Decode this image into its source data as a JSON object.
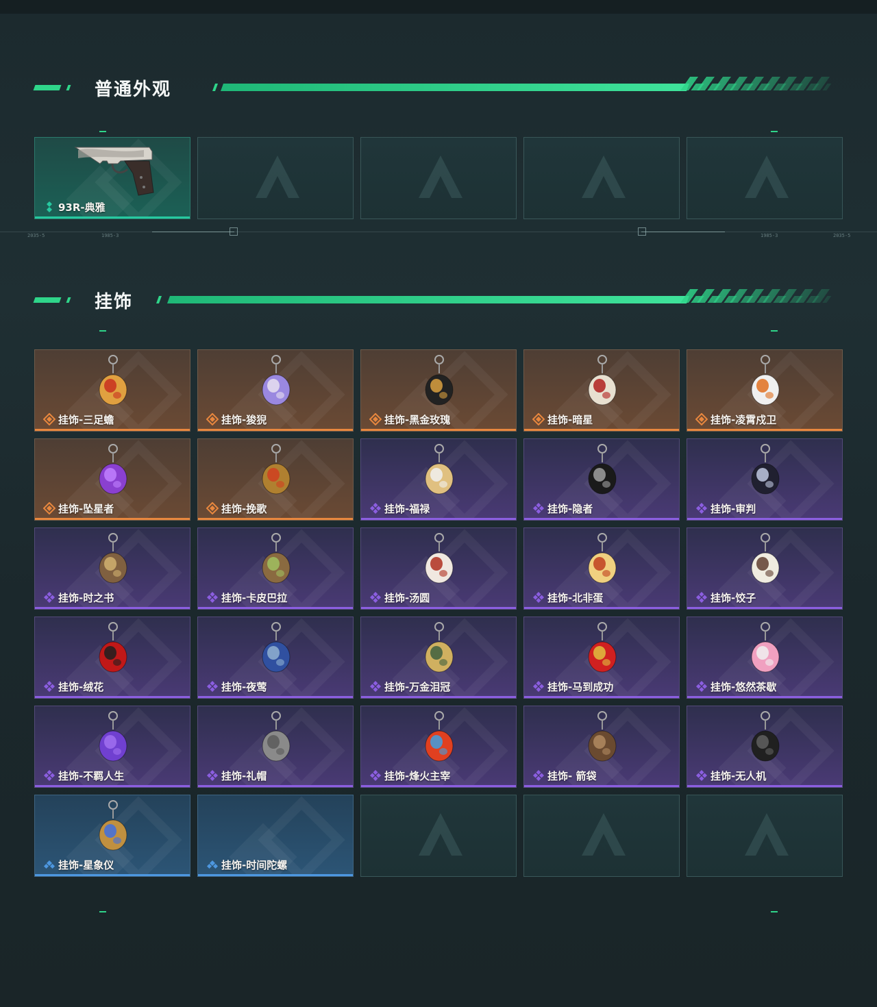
{
  "sections": [
    {
      "title": "普通外观"
    },
    {
      "title": "挂饰"
    }
  ],
  "ruler_labels": [
    "2035-5",
    "1985-3",
    "1985-3",
    "2035-5"
  ],
  "colors": {
    "accent": "#2fd58a",
    "rarity_green": "#27c9a0",
    "rarity_orange": "#e8873e",
    "rarity_purple": "#8b5ee0",
    "rarity_blue": "#4d97e0"
  },
  "skins": [
    {
      "label": "93R-典雅",
      "rarity": "green",
      "icon": "pistol-icon"
    },
    {
      "label": "",
      "rarity": "empty"
    },
    {
      "label": "",
      "rarity": "empty"
    },
    {
      "label": "",
      "rarity": "empty"
    },
    {
      "label": "",
      "rarity": "empty"
    }
  ],
  "charms": [
    {
      "label": "挂饰-三足蟾",
      "rarity": "orange",
      "icon": "toad-charm-icon",
      "c1": "#e0a040",
      "c2": "#c83020"
    },
    {
      "label": "挂饰-狻猊",
      "rarity": "orange",
      "icon": "lion-charm-icon",
      "c1": "#9a88e0",
      "c2": "#e8e0f0"
    },
    {
      "label": "挂饰-黑金玫瑰",
      "rarity": "orange",
      "icon": "black-gold-rose-icon",
      "c1": "#222",
      "c2": "#d9a040"
    },
    {
      "label": "挂饰-暗星",
      "rarity": "orange",
      "icon": "dark-star-icon",
      "c1": "#e8e0d0",
      "c2": "#b02020"
    },
    {
      "label": "挂饰-凌霄戍卫",
      "rarity": "orange",
      "icon": "guardian-charm-icon",
      "c1": "#f0f0f0",
      "c2": "#e07020"
    },
    {
      "label": "挂饰-坠星者",
      "rarity": "orange",
      "icon": "crystal-charm-icon",
      "c1": "#8a40d0",
      "c2": "#c080ff"
    },
    {
      "label": "挂饰-挽歌",
      "rarity": "orange",
      "icon": "elegy-charm-icon",
      "c1": "#b08030",
      "c2": "#d04020"
    },
    {
      "label": "挂饰-福禄",
      "rarity": "purple",
      "icon": "gourd-charm-icon",
      "c1": "#e0c080",
      "c2": "#f0f0f0"
    },
    {
      "label": "挂饰-隐者",
      "rarity": "purple",
      "icon": "hermit-card-icon",
      "c1": "#1a1a1a",
      "c2": "#a0a0a0"
    },
    {
      "label": "挂饰-审判",
      "rarity": "purple",
      "icon": "judgement-card-icon",
      "c1": "#202030",
      "c2": "#c0c8e0"
    },
    {
      "label": "挂饰-时之书",
      "rarity": "purple",
      "icon": "book-charm-icon",
      "c1": "#806040",
      "c2": "#d0b070"
    },
    {
      "label": "挂饰-卡皮巴拉",
      "rarity": "purple",
      "icon": "capybara-charm-icon",
      "c1": "#8a6a40",
      "c2": "#a0c060"
    },
    {
      "label": "挂饰-汤圆",
      "rarity": "purple",
      "icon": "tangyuan-charm-icon",
      "c1": "#f0e8e0",
      "c2": "#b03020"
    },
    {
      "label": "挂饰-北非蛋",
      "rarity": "purple",
      "icon": "shakshuka-charm-icon",
      "c1": "#f0d080",
      "c2": "#c04020"
    },
    {
      "label": "挂饰-饺子",
      "rarity": "purple",
      "icon": "dumpling-charm-icon",
      "c1": "#f0ece0",
      "c2": "#604030"
    },
    {
      "label": "挂饰-绒花",
      "rarity": "purple",
      "icon": "velvet-flower-icon",
      "c1": "#c01818",
      "c2": "#202020"
    },
    {
      "label": "挂饰-夜莺",
      "rarity": "purple",
      "icon": "feather-charm-icon",
      "c1": "#3050a0",
      "c2": "#90b0d0"
    },
    {
      "label": "挂饰-万金泪冠",
      "rarity": "purple",
      "icon": "crown-charm-icon",
      "c1": "#d0b060",
      "c2": "#406040"
    },
    {
      "label": "挂饰-马到成功",
      "rarity": "purple",
      "icon": "horse-charm-icon",
      "c1": "#d02020",
      "c2": "#e0c040"
    },
    {
      "label": "挂饰-悠然茶歇",
      "rarity": "purple",
      "icon": "cupcake-charm-icon",
      "c1": "#f0a0c0",
      "c2": "#f0f0f0"
    },
    {
      "label": "挂饰-不羁人生",
      "rarity": "purple",
      "icon": "sneaker-charm-icon",
      "c1": "#7040d0",
      "c2": "#a070f0"
    },
    {
      "label": "挂饰-礼帽",
      "rarity": "purple",
      "icon": "hat-charm-icon",
      "c1": "#8a8a8a",
      "c2": "#5a5a5a"
    },
    {
      "label": "挂饰-烽火主宰",
      "rarity": "purple",
      "icon": "banner-charm-icon",
      "c1": "#e04020",
      "c2": "#40a0e0"
    },
    {
      "label": "挂饰- 箭袋",
      "rarity": "purple",
      "icon": "quiver-charm-icon",
      "c1": "#6a4a30",
      "c2": "#b08a60"
    },
    {
      "label": "挂饰-无人机",
      "rarity": "purple",
      "icon": "drone-charm-icon",
      "c1": "#202020",
      "c2": "#606060"
    },
    {
      "label": "挂饰-星象仪",
      "rarity": "blue",
      "icon": "astrolabe-charm-icon",
      "c1": "#c09040",
      "c2": "#4070e0"
    },
    {
      "label": "挂饰-时间陀螺",
      "rarity": "blue",
      "icon": "",
      "c1": "",
      "c2": ""
    },
    {
      "label": "",
      "rarity": "empty"
    },
    {
      "label": "",
      "rarity": "empty"
    },
    {
      "label": "",
      "rarity": "empty"
    }
  ]
}
